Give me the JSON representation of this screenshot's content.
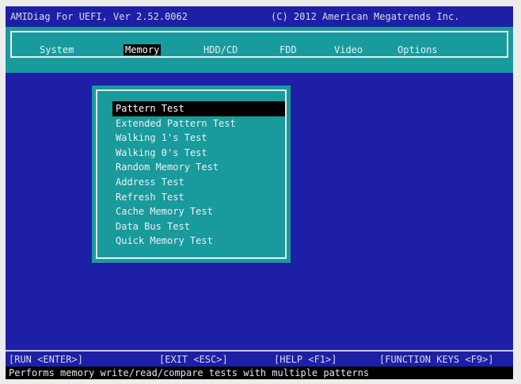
{
  "title_bar": {
    "left": "AMIDiag For UEFI, Ver 2.52.0062",
    "right": "(C) 2012 American Megatrends Inc."
  },
  "menu": {
    "items": [
      {
        "label": "System",
        "active": false
      },
      {
        "label": "Memory",
        "active": true
      },
      {
        "label": "HDD/CD",
        "active": false
      },
      {
        "label": "FDD",
        "active": false
      },
      {
        "label": "Video",
        "active": false
      },
      {
        "label": "Options",
        "active": false
      }
    ]
  },
  "tests": {
    "selected_index": 0,
    "items": [
      "Pattern Test",
      "Extended Pattern Test",
      "Walking 1's Test",
      "Walking 0's Test",
      "Random Memory Test",
      "Address Test",
      "Refresh Test",
      "Cache Memory Test",
      "Data Bus Test",
      "Quick Memory Test"
    ]
  },
  "function_keys": {
    "run": "[RUN <ENTER>]",
    "exit": "[EXIT <ESC>]",
    "help": "[HELP <F1>]",
    "function_keys": "[FUNCTION KEYS <F9>]"
  },
  "status": {
    "description": "Performs memory write/read/compare tests with multiple patterns"
  },
  "colors": {
    "background": "#1d1fa6",
    "panel": "#199a9c",
    "highlight": "#000000",
    "text": "#e9f3f3"
  }
}
